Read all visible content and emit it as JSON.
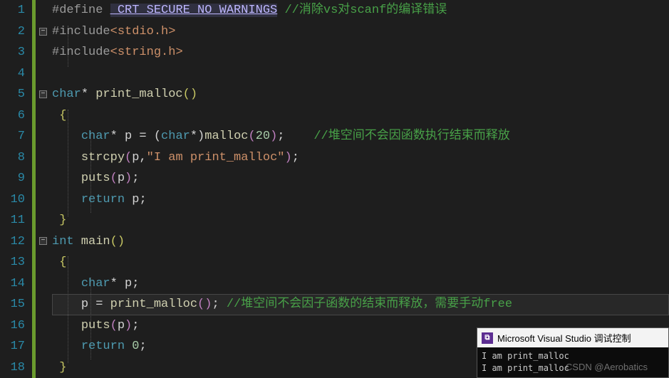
{
  "line_numbers": [
    "1",
    "2",
    "3",
    "4",
    "5",
    "6",
    "7",
    "8",
    "9",
    "10",
    "11",
    "12",
    "13",
    "14",
    "15",
    "16",
    "17",
    "18"
  ],
  "code": {
    "l1_define": "#define ",
    "l1_macro": "_CRT_SECURE_NO_WARNINGS",
    "l1_comment": " //消除vs对scanf的编译错误",
    "l2_inc": "#include",
    "l2_hdr": "<stdio.h>",
    "l3_inc": "#include",
    "l3_hdr": "<string.h>",
    "l5_type": "char",
    "l5_star": "* ",
    "l5_fn": "print_malloc",
    "l6_brace": "{",
    "l7_type": "char",
    "l7_star": "* ",
    "l7_var": "p",
    "l7_eq": " = (",
    "l7_cast": "char",
    "l7_cast2": "*)",
    "l7_malloc": "malloc",
    "l7_num": "20",
    "l7_end": ");",
    "l7_comment": "//堆空间不会因函数执行结束而释放",
    "l8_strcpy": "strcpy",
    "l8_args_open": "(",
    "l8_p": "p",
    "l8_comma": ",",
    "l8_str": "\"I am print_malloc\"",
    "l8_close": ");",
    "l9_puts": "puts",
    "l9_p": "p",
    "l10_return": "return ",
    "l10_p": "p",
    "l11_brace": "}",
    "l12_int": "int",
    "l12_main": " main",
    "l13_brace": "{",
    "l14_type": "char",
    "l14_star": "* ",
    "l14_p": "p",
    "l15_p": "p",
    "l15_eq": " = ",
    "l15_fn": "print_malloc",
    "l15_comment": "//堆空间不会因子函数的结束而释放，需要手动free",
    "l16_puts": "puts",
    "l16_p": "p",
    "l17_return": "return ",
    "l17_zero": "0",
    "l18_brace": "}"
  },
  "console": {
    "title": "Microsoft Visual Studio 调试控制",
    "out1": "I am print_malloc",
    "out2": "I am print_malloc"
  },
  "watermark": "CSDN @Aerobatics"
}
